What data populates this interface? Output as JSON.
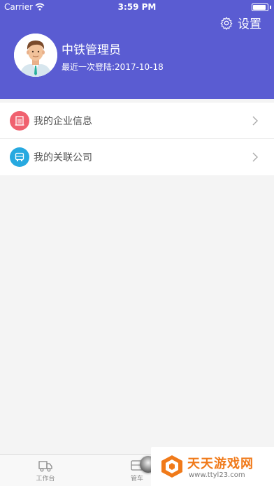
{
  "status_bar": {
    "carrier": "Carrier",
    "time": "3:59 PM",
    "battery_level": 0.9
  },
  "header": {
    "settings_label": "设置",
    "user_name": "中铁管理员",
    "last_login": "最近一次登陆:2017-10-18",
    "background_color": "#5a5cd2"
  },
  "menu": {
    "items": [
      {
        "label": "我的企业信息",
        "icon": "building-icon",
        "icon_color": "#f0616f"
      },
      {
        "label": "我的关联公司",
        "icon": "truck-icon",
        "icon_color": "#27a9e0"
      }
    ]
  },
  "tabbar": {
    "tabs": [
      {
        "label": "工作台",
        "icon": "truck-outline-icon"
      },
      {
        "label": "管车",
        "icon": "car-box-icon"
      }
    ]
  },
  "watermark": {
    "title": "天天游戏网",
    "url": "www.ttyl23.com",
    "logo_color": "#f07a1a"
  }
}
